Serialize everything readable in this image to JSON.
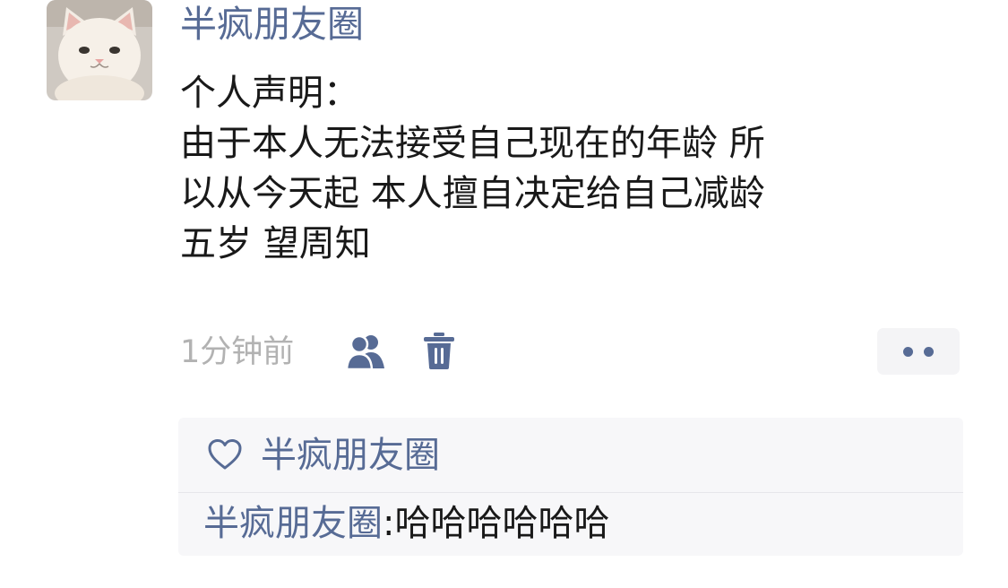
{
  "post": {
    "author": "半疯朋友圈",
    "avatar_icon": "cat-avatar",
    "text_lines": [
      "个人声明：",
      "由于本人无法接受自己现在的年龄 所",
      "以从今天起 本人擅自决定给自己减龄",
      "五岁 望周知"
    ],
    "time": "1分钟前",
    "visibility_icon": "friends-icon",
    "delete_icon": "trash-icon",
    "more_icon": "more-dots-icon"
  },
  "likes": {
    "icon": "heart-icon",
    "names": "半疯朋友圈"
  },
  "comments": [
    {
      "author": "半疯朋友圈",
      "separator": ":",
      "text": "哈哈哈哈哈哈"
    }
  ],
  "colors": {
    "link_blue": "#576b95",
    "text": "#191919",
    "muted": "#b2b2b2",
    "comment_bg": "#f7f7f9"
  }
}
